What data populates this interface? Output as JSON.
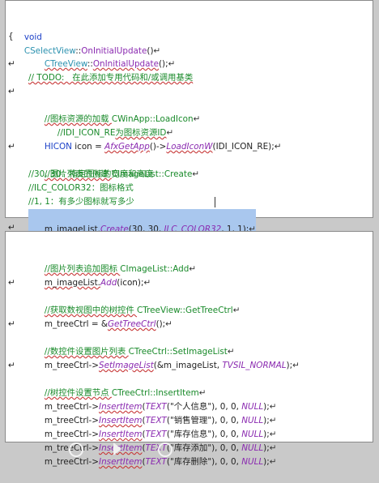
{
  "top": {
    "l1_kw": "void",
    "l1_cls": "CSelectView",
    "l1_sep": "::",
    "l1_fn": "OnInitialUpdate",
    "l1_end": "()",
    "l2": "{",
    "l3_cls": "CTreeView",
    "l3_sep": "::",
    "l3_fn": "OnInitialUpdate",
    "l3_end": "();",
    "l4": "// TODO:   在此添加专用代码和/或调用基类",
    "l5_a": "//图标资源的加载 ",
    "l5_b": "CWinApp::LoadIcon",
    "l6_a": "//IDI_ICON_RE",
    "l6_b": "为图标资源ID",
    "l7_kw": "HICON",
    "l7_a": " icon = ",
    "l7_fn1": "AfxGetApp",
    "l7_b": "()->",
    "l7_fn2": "LoadIconW",
    "l7_c": "(IDI_ICON_RE);",
    "l8_a": "//图片列表的创建 ",
    "l8_b": "CImageList::Create",
    "l9": "//30, 30：指定图标的宽度和高度",
    "l10": "//ILC_COLOR32：图标格式",
    "l11": "//1, 1：有多少图标就写多少",
    "l12_a": "m_imageList.",
    "l12_fn": "Create",
    "l12_b": "(30, 30, ",
    "l12_c": "ILC_COLOR32",
    "l12_d": ", 1, 1);"
  },
  "bottom": {
    "b1_a": "//图片列表追加图标 ",
    "b1_b": "CImageList::Add",
    "b2_a": "m_imageList.",
    "b2_fn": "Add",
    "b2_b": "(icon);",
    "b3_a": "//获取数视图中的树控件 ",
    "b3_b": "CTreeView::GetTreeCtrl",
    "b4_a": "m_treeCtrl = &",
    "b4_fn": "GetTreeCtrl",
    "b4_b": "();",
    "b5_a": "//数控件设置图片列表 ",
    "b5_b": "CTreeCtrl::SetImageList",
    "b6_a": "m_treeCtrl->",
    "b6_fn": "SetImageList",
    "b6_b": "(&m_imageList, ",
    "b6_c": "TVSIL_NORMAL",
    "b6_d": ");",
    "b7_a": "//树控件设置节点 ",
    "b7_b": "CTreeCtrl::InsertItem",
    "items": [
      {
        "a": "m_treeCtrl->",
        "fn": "InsertItem",
        "b": "(",
        "t": "TEXT",
        "s": "(\"个人信息\"), 0, 0, ",
        "n": "NULL",
        "e": ");"
      },
      {
        "a": "m_treeCtrl->",
        "fn": "InsertItem",
        "b": "(",
        "t": "TEXT",
        "s": "(\"销售管理\"), 0, 0, ",
        "n": "NULL",
        "e": ");"
      },
      {
        "a": "m_treeCtrl->",
        "fn": "InsertItem",
        "b": "(",
        "t": "TEXT",
        "s": "(\"库存信息\"), 0, 0, ",
        "n": "NULL",
        "e": ");"
      },
      {
        "a": "m_treeCtrl->",
        "fn": "InsertItem",
        "b": "(",
        "t": "TEXT",
        "s": "(\"库存添加\"), 0, 0, ",
        "n": "NULL",
        "e": ");"
      },
      {
        "a": "m_treeCtrl->",
        "fn": "InsertItem",
        "b": "(",
        "t": "TEXT",
        "s": "(\"库存删除\"), 0, 0, ",
        "n": "NULL",
        "e": ");"
      }
    ]
  },
  "para_mark": "↵"
}
